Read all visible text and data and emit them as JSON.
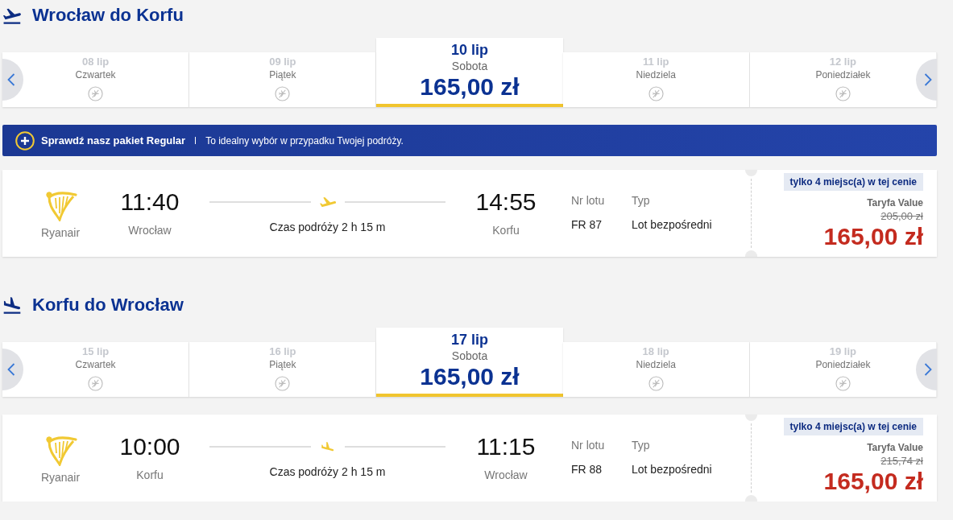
{
  "sections": [
    {
      "kind": "outbound",
      "title": "Wrocław do Korfu",
      "dates": [
        {
          "date": "08 lip",
          "day": "Czwartek",
          "selected": false
        },
        {
          "date": "09 lip",
          "day": "Piątek",
          "selected": false
        },
        {
          "date": "10 lip",
          "day": "Sobota",
          "price": "165,00 zł",
          "selected": true
        },
        {
          "date": "11 lip",
          "day": "Niedziela",
          "selected": false
        },
        {
          "date": "12 lip",
          "day": "Poniedziałek",
          "selected": false
        }
      ],
      "banner": {
        "title": "Sprawdź nasz pakiet Regular",
        "text": "To idealny wybór w przypadku Twojej podróży."
      },
      "flights": [
        {
          "airline": "Ryanair",
          "departure": {
            "time": "11:40",
            "city": "Wrocław"
          },
          "duration": "Czas podróży 2 h 15 m",
          "arrival": {
            "time": "14:55",
            "city": "Korfu"
          },
          "flight_number_label": "Nr lotu",
          "flight_number": "FR 87",
          "type_label": "Typ",
          "type": "Lot bezpośredni",
          "availability": "tylko 4 miejsc(a) w tej cenie",
          "fare": "Taryfa Value",
          "old_price": "205,00 zł",
          "price": "165,00 zł"
        }
      ]
    },
    {
      "kind": "return",
      "title": "Korfu do Wrocław",
      "dates": [
        {
          "date": "15 lip",
          "day": "Czwartek",
          "selected": false
        },
        {
          "date": "16 lip",
          "day": "Piątek",
          "selected": false
        },
        {
          "date": "17 lip",
          "day": "Sobota",
          "price": "165,00 zł",
          "selected": true
        },
        {
          "date": "18 lip",
          "day": "Niedziela",
          "selected": false
        },
        {
          "date": "19 lip",
          "day": "Poniedziałek",
          "selected": false
        }
      ],
      "flights": [
        {
          "airline": "Ryanair",
          "departure": {
            "time": "10:00",
            "city": "Korfu"
          },
          "duration": "Czas podróży 2 h 15 m",
          "arrival": {
            "time": "11:15",
            "city": "Wrocław"
          },
          "flight_number_label": "Nr lotu",
          "flight_number": "FR 88",
          "type_label": "Typ",
          "type": "Lot bezpośredni",
          "availability": "tylko 4 miejsc(a) w tej cenie",
          "fare": "Taryfa Value",
          "old_price": "215,74 zł",
          "price": "165,00 zł"
        }
      ]
    }
  ]
}
